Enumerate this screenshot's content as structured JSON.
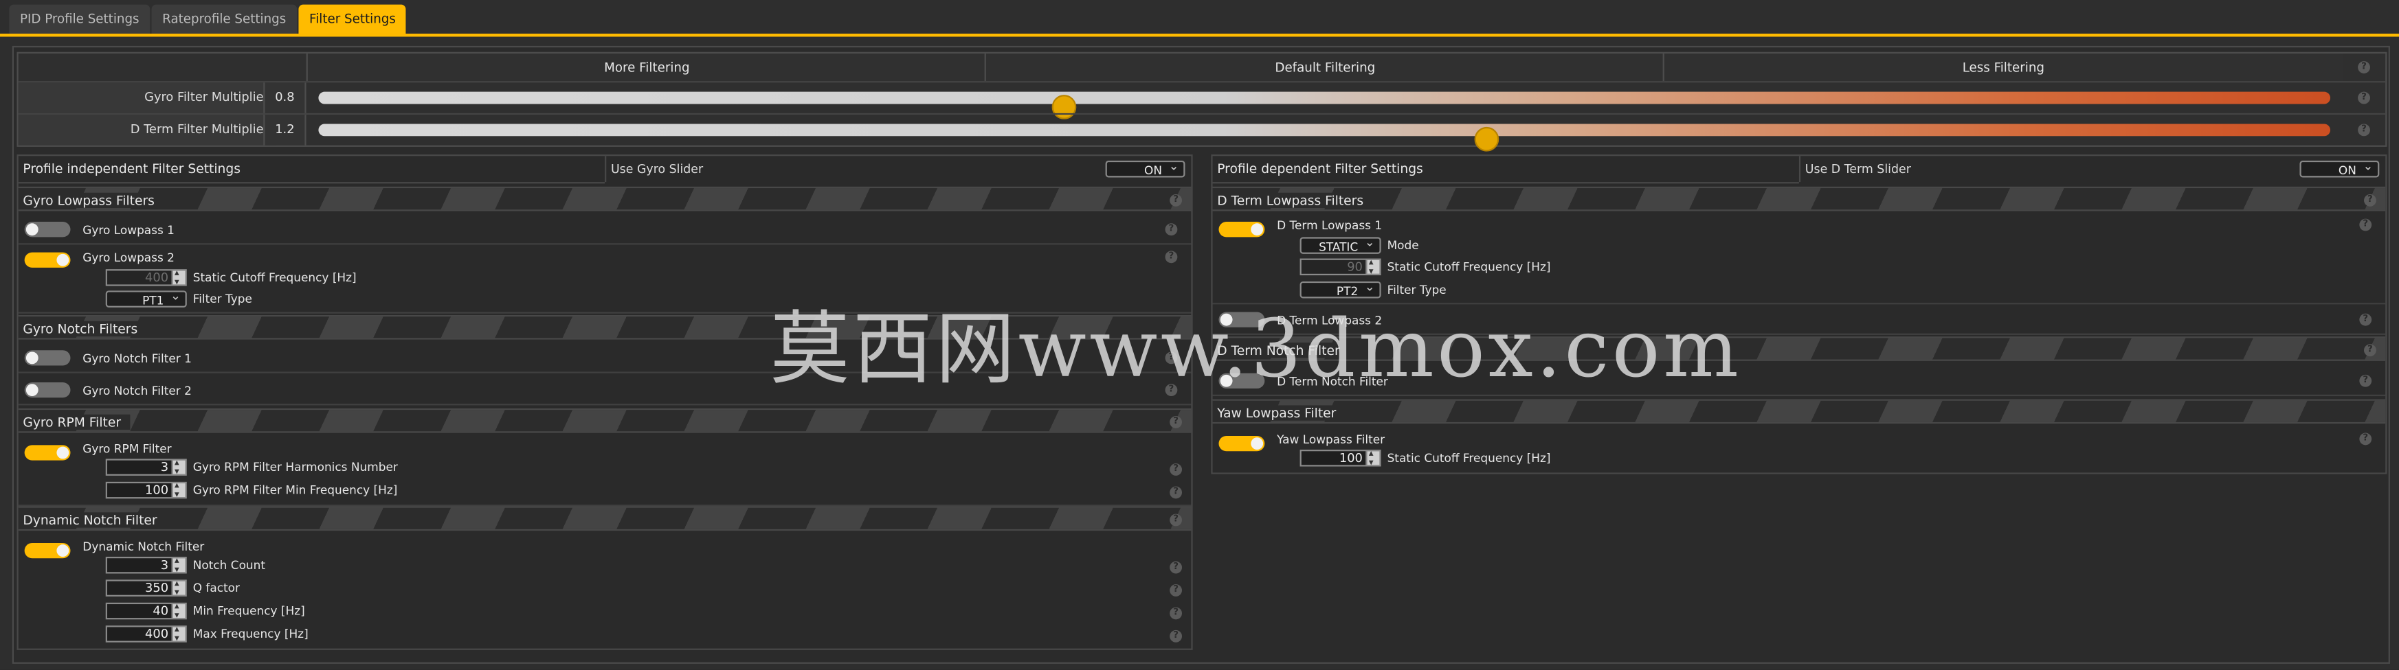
{
  "tabs": [
    "PID Profile Settings",
    "Rateprofile Settings",
    "Filter Settings"
  ],
  "slider_header": {
    "more": "More Filtering",
    "default": "Default Filtering",
    "less": "Less Filtering"
  },
  "sliders": [
    {
      "label": "Gyro Filter Multiplier:",
      "value": "0.8",
      "position": 0.37
    },
    {
      "label": "D Term Filter Multiplier:",
      "value": "1.2",
      "position": 0.58
    }
  ],
  "left": {
    "title": "Profile independent Filter Settings",
    "slider_label": "Use Gyro Slider",
    "slider_value": "ON",
    "sections": {
      "lowpass": "Gyro Lowpass Filters",
      "lowpass1": "Gyro Lowpass 1",
      "lowpass2": "Gyro Lowpass 2",
      "lp2_cutoff_value": "400",
      "lp2_cutoff_label": "Static Cutoff Frequency [Hz]",
      "lp2_type_value": "PT1",
      "lp2_type_label": "Filter Type",
      "notch": "Gyro Notch Filters",
      "notch1": "Gyro Notch Filter 1",
      "notch2": "Gyro Notch Filter 2",
      "rpm": "Gyro RPM Filter",
      "rpm_toggle": "Gyro RPM Filter",
      "rpm_harm_value": "3",
      "rpm_harm_label": "Gyro RPM Filter Harmonics Number",
      "rpm_min_value": "100",
      "rpm_min_label": "Gyro RPM Filter Min Frequency [Hz]",
      "dyn": "Dynamic Notch Filter",
      "dyn_toggle": "Dynamic Notch Filter",
      "dyn_count_value": "3",
      "dyn_count_label": "Notch Count",
      "dyn_q_value": "350",
      "dyn_q_label": "Q factor",
      "dyn_min_value": "40",
      "dyn_min_label": "Min Frequency [Hz]",
      "dyn_max_value": "400",
      "dyn_max_label": "Max Frequency [Hz]"
    }
  },
  "right": {
    "title": "Profile dependent Filter Settings",
    "slider_label": "Use D Term Slider",
    "slider_value": "ON",
    "sections": {
      "dlowpass": "D Term Lowpass Filters",
      "dlp1": "D Term Lowpass 1",
      "dlp1_mode_value": "STATIC",
      "dlp1_mode_label": "Mode",
      "dlp1_cutoff_value": "90",
      "dlp1_cutoff_label": "Static Cutoff Frequency [Hz]",
      "dlp1_type_value": "PT2",
      "dlp1_type_label": "Filter Type",
      "dlp2": "D Term Lowpass 2",
      "dnotch": "D Term Notch Filter",
      "dnotch_toggle": "D Term Notch Filter",
      "yaw": "Yaw Lowpass Filter",
      "yaw_toggle": "Yaw Lowpass Filter",
      "yaw_cutoff_value": "100",
      "yaw_cutoff_label": "Static Cutoff Frequency [Hz]"
    }
  },
  "help_glyph": "?",
  "watermark": "莫西网www.3dmox.com",
  "colors": {
    "accent": "#ffbb00",
    "slider_start": "#d8d8d8",
    "slider_end": "#cc4f22"
  }
}
